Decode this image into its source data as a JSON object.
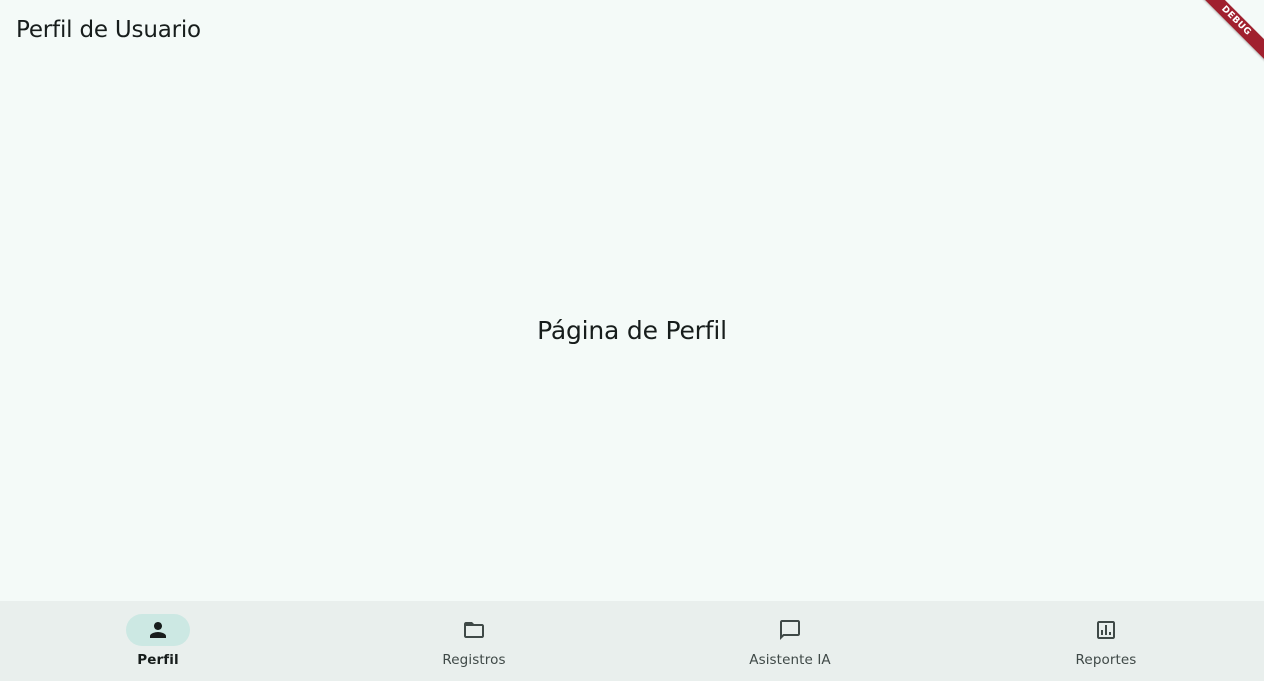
{
  "app_bar": {
    "title": "Perfil de Usuario"
  },
  "body": {
    "center_text": "Página de Perfil"
  },
  "debug_banner": {
    "label": "DEBUG"
  },
  "navigation": {
    "items": [
      {
        "label": "Perfil",
        "icon": "person-icon",
        "active": true
      },
      {
        "label": "Registros",
        "icon": "folder-icon",
        "active": false
      },
      {
        "label": "Asistente IA",
        "icon": "chat-icon",
        "active": false
      },
      {
        "label": "Reportes",
        "icon": "bar-chart-icon",
        "active": false
      }
    ]
  },
  "colors": {
    "background": "#f4faf8",
    "nav_background": "#e9efed",
    "active_indicator": "#cce8e3",
    "text": "#171d1c",
    "debug_ribbon": "#a0202e"
  }
}
